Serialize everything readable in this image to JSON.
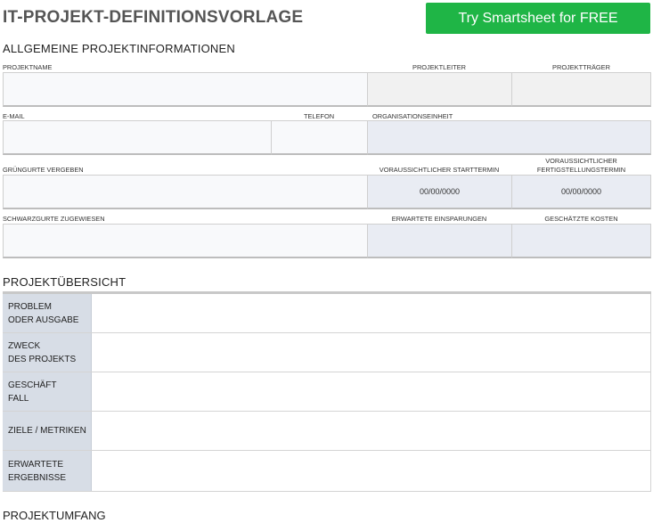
{
  "header": {
    "title": "IT-PROJEKT-DEFINITIONSVORLAGE",
    "cta_label": "Try Smartsheet for FREE"
  },
  "general": {
    "heading": "ALLGEMEINE PROJEKTINFORMATIONEN",
    "labels": {
      "project_name": "PROJEKTNAME",
      "project_lead": "PROJEKTLEITER",
      "project_sponsor": "PROJEKTTRÄGER",
      "email": "E-MAIL",
      "phone": "TELEFON",
      "org_unit": "ORGANISATIONSEINHEIT",
      "green_belts": "GRÜNGURTE VERGEBEN",
      "start_date": "VORAUSSICHTLICHER STARTTERMIN",
      "end_date_line1": "VORAUSSICHTLICHER",
      "end_date_line2": "FERTIGSTELLUNGSTERMIN",
      "black_belts": "SCHWARZGURTE ZUGEWIESEN",
      "expected_savings": "ERWARTETE EINSPARUNGEN",
      "estimated_costs": "GESCHÄTZTE KOSTEN"
    },
    "values": {
      "project_name": "",
      "project_lead": "",
      "project_sponsor": "",
      "email": "",
      "phone": "",
      "org_unit": "",
      "green_belts": "",
      "start_date": "00/00/0000",
      "end_date": "00/00/0000",
      "black_belts": "",
      "expected_savings": "",
      "estimated_costs": ""
    }
  },
  "overview": {
    "heading": "PROJEKTÜBERSICHT",
    "rows": [
      {
        "line1": "PROBLEM",
        "line2": "ODER AUSGABE",
        "value": ""
      },
      {
        "line1": "ZWECK",
        "line2": "DES PROJEKTS",
        "value": ""
      },
      {
        "line1": "GESCHÄFT",
        "line2": "FALL",
        "value": ""
      },
      {
        "line1": "ZIELE / METRIKEN",
        "line2": "",
        "value": ""
      },
      {
        "line1": "ERWARTETE",
        "line2": "ERGEBNISSE",
        "value": ""
      }
    ]
  },
  "scope": {
    "heading": "PROJEKTUMFANG"
  }
}
